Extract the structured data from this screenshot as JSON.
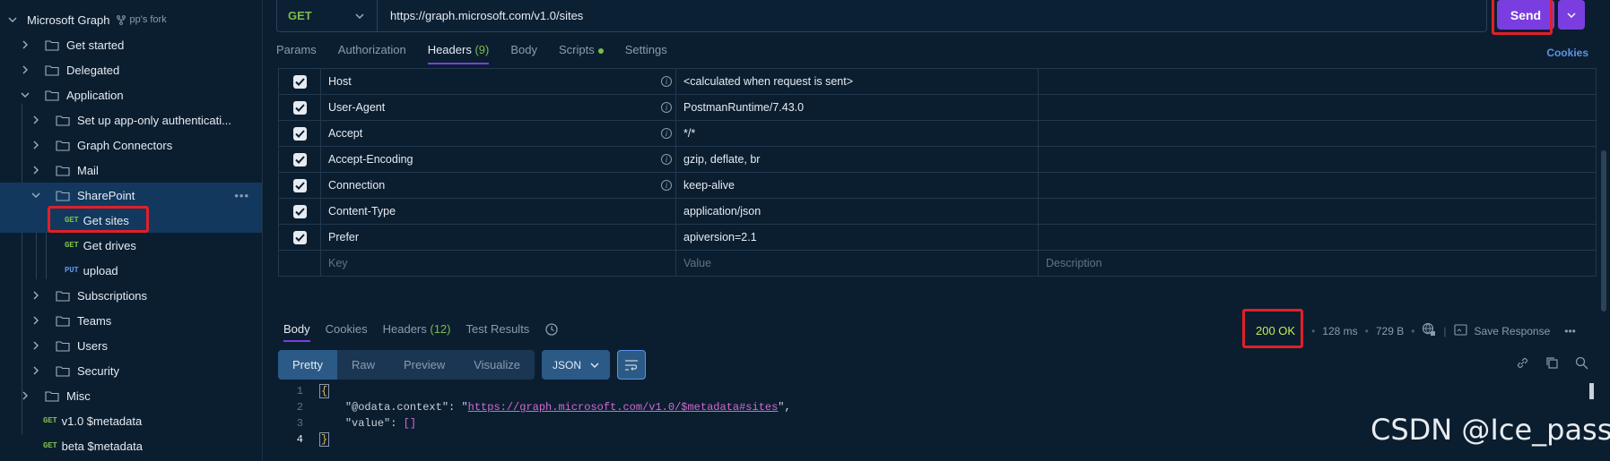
{
  "sidebar": {
    "root": {
      "label": "Microsoft Graph",
      "fork": "pp's fork"
    },
    "items": [
      {
        "label": "Get started"
      },
      {
        "label": "Delegated"
      },
      {
        "label": "Application"
      },
      {
        "label": "Set up app-only authenticati..."
      },
      {
        "label": "Graph Connectors"
      },
      {
        "label": "Mail"
      },
      {
        "label": "SharePoint"
      },
      {
        "method": "GET",
        "label": "Get sites"
      },
      {
        "method": "GET",
        "label": "Get drives"
      },
      {
        "method": "PUT",
        "label": "upload"
      },
      {
        "label": "Subscriptions"
      },
      {
        "label": "Teams"
      },
      {
        "label": "Users"
      },
      {
        "label": "Security"
      },
      {
        "label": "Misc"
      },
      {
        "method": "GET",
        "label": "v1.0 $metadata"
      },
      {
        "method": "GET",
        "label": "beta $metadata"
      }
    ],
    "more_dots": "•••"
  },
  "request": {
    "method": "GET",
    "url": "https://graph.microsoft.com/v1.0/sites",
    "send_label": "Send",
    "tabs": [
      {
        "label": "Params"
      },
      {
        "label": "Authorization"
      },
      {
        "label": "Headers",
        "count": "(9)"
      },
      {
        "label": "Body"
      },
      {
        "label": "Scripts"
      },
      {
        "label": "Settings"
      }
    ],
    "cookies_label": "Cookies"
  },
  "headers": {
    "rows": [
      {
        "key": "Host",
        "value": "<calculated when request is sent>",
        "info": true
      },
      {
        "key": "User-Agent",
        "value": "PostmanRuntime/7.43.0",
        "info": true
      },
      {
        "key": "Accept",
        "value": "*/*",
        "info": true
      },
      {
        "key": "Accept-Encoding",
        "value": "gzip, deflate, br",
        "info": true
      },
      {
        "key": "Connection",
        "value": "keep-alive",
        "info": true
      },
      {
        "key": "Content-Type",
        "value": "application/json",
        "info": false
      },
      {
        "key": "Prefer",
        "value": "apiversion=2.1",
        "info": false
      }
    ],
    "placeholders": {
      "key": "Key",
      "value": "Value",
      "description": "Description"
    }
  },
  "response": {
    "tabs": [
      {
        "label": "Body"
      },
      {
        "label": "Cookies"
      },
      {
        "label": "Headers",
        "count": "(12)"
      },
      {
        "label": "Test Results"
      }
    ],
    "status": "200 OK",
    "time": "128 ms",
    "size": "729 B",
    "save_label": "Save Response",
    "more": "•••",
    "formats": [
      "Pretty",
      "Raw",
      "Preview",
      "Visualize"
    ],
    "format_type": "JSON",
    "line_numbers": [
      "1",
      "2",
      "3",
      "4"
    ],
    "body": {
      "open": "{",
      "close": "}",
      "key1": "\"@odata.context\"",
      "colon1": ": ",
      "val1_q1": "\"",
      "val1": "https://graph.microsoft.com/v1.0/$metadata#sites",
      "val1_q2": "\"",
      "comma1": ",",
      "key2": "\"value\"",
      "colon2": ": ",
      "val2": "[]"
    }
  },
  "watermark": "CSDN @Ice_pass",
  "colors": {
    "accent": "#7a3ee0",
    "get": "#7dbb4a",
    "put": "#5c93e6",
    "status": "#c5e85a",
    "highlight": "#e0202a"
  }
}
